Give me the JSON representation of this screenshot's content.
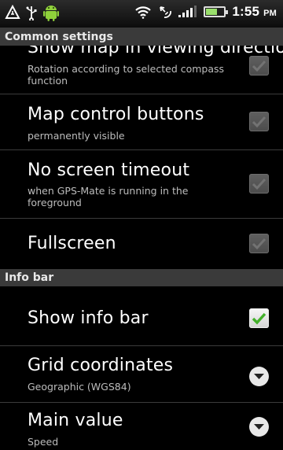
{
  "status_bar": {
    "time": "1:55",
    "ampm": "PM",
    "battery_fill_fraction": 0.6,
    "icons": [
      "usb-warning-icon",
      "usb-icon",
      "android-icon",
      "wifi-icon",
      "gps-icon",
      "signal-icon",
      "battery-icon"
    ]
  },
  "sections": {
    "common_settings": "Common settings",
    "info_bar": "Info bar"
  },
  "settings": [
    {
      "title": "Show map in viewing direction",
      "subtitle": "Rotation according to selected compass function",
      "control": "checkbox",
      "checked": false,
      "enabled": false
    },
    {
      "title": "Map control buttons",
      "subtitle": "permanently visible",
      "control": "checkbox",
      "checked": false,
      "enabled": false
    },
    {
      "title": "No screen timeout",
      "subtitle": "when GPS-Mate is running in the foreground",
      "control": "checkbox",
      "checked": false,
      "enabled": false
    },
    {
      "title": "Fullscreen",
      "subtitle": "",
      "control": "checkbox",
      "checked": false,
      "enabled": false
    },
    {
      "title": "Show info bar",
      "subtitle": "",
      "control": "checkbox",
      "checked": true,
      "enabled": true
    },
    {
      "title": "Grid coordinates",
      "subtitle": "Geographic (WGS84)",
      "control": "dropdown"
    },
    {
      "title": "Main value",
      "subtitle": "Speed",
      "control": "dropdown"
    }
  ],
  "colors": {
    "check_green": "#43b02a",
    "header_bg": "#3a3a3a",
    "subtitle": "#bdbdbd"
  }
}
